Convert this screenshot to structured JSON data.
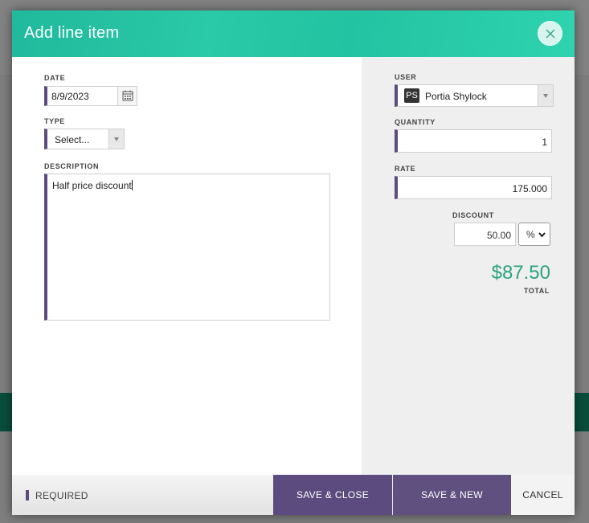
{
  "modal": {
    "title": "Add line item",
    "close_icon": "close-icon"
  },
  "form": {
    "date": {
      "label": "DATE",
      "value": "8/9/2023",
      "icon": "calendar-icon"
    },
    "type": {
      "label": "TYPE",
      "value": "Select..."
    },
    "description": {
      "label": "DESCRIPTION",
      "value": "Half price discount"
    },
    "user": {
      "label": "USER",
      "initials": "PS",
      "name": "Portia Shylock"
    },
    "quantity": {
      "label": "QUANTITY",
      "value": "1"
    },
    "rate": {
      "label": "RATE",
      "value": "175.000"
    },
    "discount": {
      "label": "DISCOUNT",
      "value": "50.00",
      "unit": "%"
    },
    "total": {
      "label": "TOTAL",
      "value": "$87.50"
    }
  },
  "footer": {
    "required_label": "REQUIRED",
    "save_close_label": "SAVE & CLOSE",
    "save_new_label": "SAVE & NEW",
    "cancel_label": "CANCEL"
  },
  "colors": {
    "accent": "#5b4b7e",
    "header": "#2ac9a7",
    "total": "#2aa37f"
  }
}
